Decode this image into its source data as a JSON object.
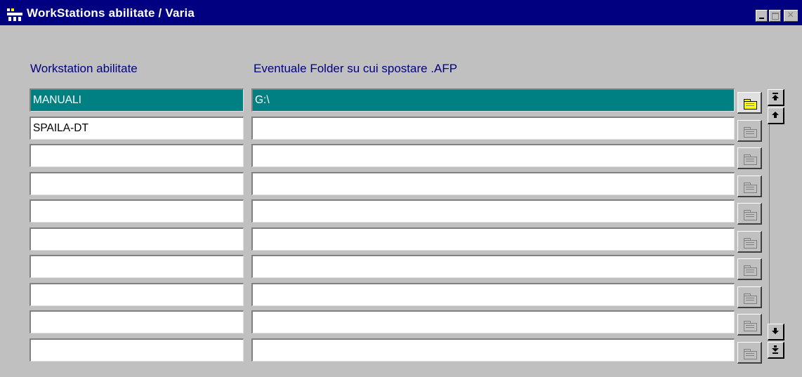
{
  "window": {
    "title": "WorkStations abilitate / Varia"
  },
  "columns": {
    "workstation_header": "Workstation abilitate",
    "folder_header": "Eventuale Folder su cui spostare .AFP"
  },
  "rows": [
    {
      "workstation": "MANUALI",
      "folder": "G:\\",
      "selected": true
    },
    {
      "workstation": "SPAILA-DT",
      "folder": "",
      "selected": false
    },
    {
      "workstation": "",
      "folder": "",
      "selected": false
    },
    {
      "workstation": "",
      "folder": "",
      "selected": false
    },
    {
      "workstation": "",
      "folder": "",
      "selected": false
    },
    {
      "workstation": "",
      "folder": "",
      "selected": false
    },
    {
      "workstation": "",
      "folder": "",
      "selected": false
    },
    {
      "workstation": "",
      "folder": "",
      "selected": false
    },
    {
      "workstation": "",
      "folder": "",
      "selected": false
    },
    {
      "workstation": "",
      "folder": "",
      "selected": false
    }
  ],
  "icons": {
    "app": "app-icon",
    "browse": "folder-icon",
    "scroll_first": "scroll-first-icon",
    "scroll_up": "scroll-up-icon",
    "scroll_down": "scroll-down-icon",
    "scroll_last": "scroll-last-icon"
  },
  "colors": {
    "titlebar": "#000080",
    "selection": "#008080",
    "header_text": "#000080",
    "background": "#c0c0c0"
  }
}
